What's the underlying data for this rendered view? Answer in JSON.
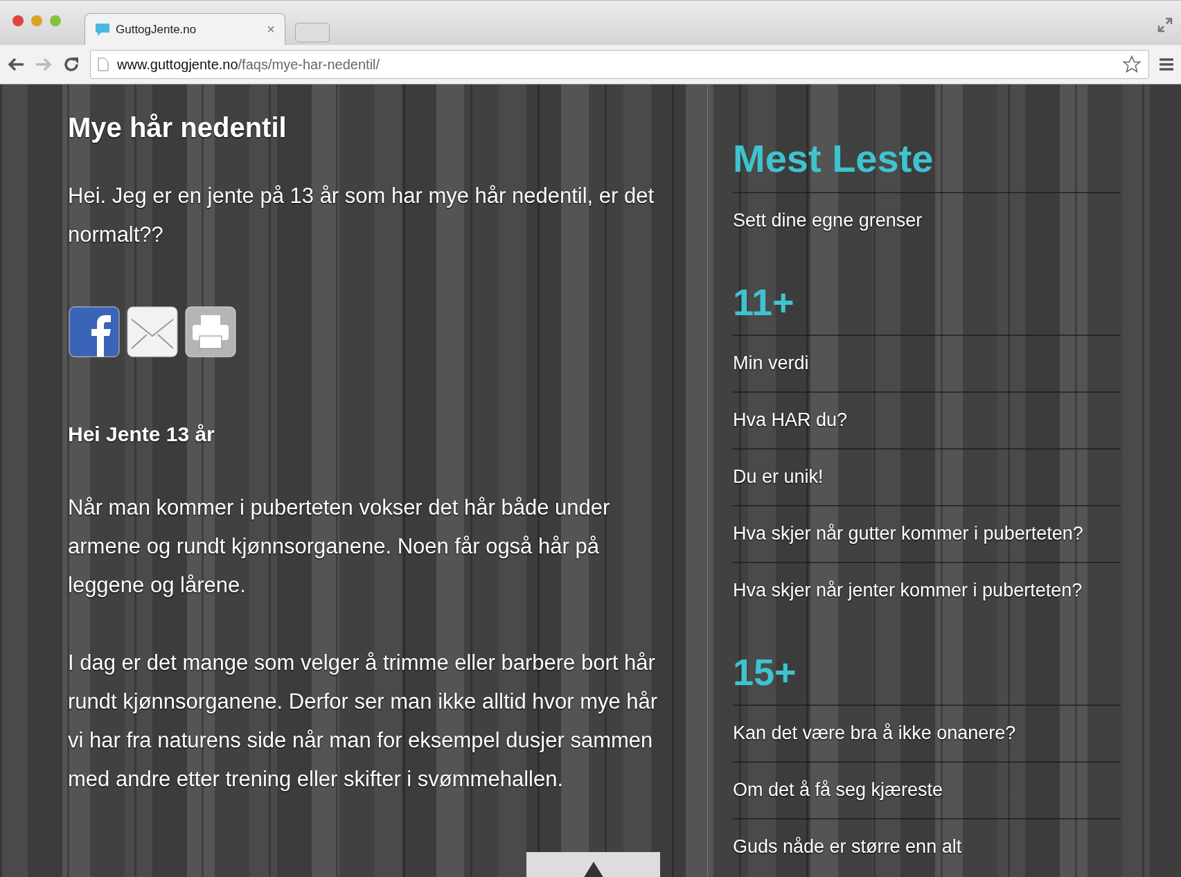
{
  "browser": {
    "tab": {
      "title": "GuttogJente.no",
      "close": "×"
    },
    "url": {
      "host": "www.guttogjente.no",
      "path": "/faqs/mye-har-nedentil/"
    }
  },
  "article": {
    "title": "Mye hår nedentil",
    "question": "Hei. Jeg er en jente på 13 år som har mye hår nedentil, er det normalt??",
    "greeting": "Hei Jente 13 år",
    "paragraphs": [
      "Når man kommer i puberteten vokser det hår både under armene og rundt kjønnsorganene. Noen får også hår på leggene og lårene.",
      "I dag er det mange som velger å trimme eller barbere bort hår rundt kjønnsorganene. Derfor ser man ikke alltid hvor mye hår vi har fra naturens side når man for eksempel dusjer sammen med andre etter trening eller skifter i svømmehallen."
    ]
  },
  "sidebar": {
    "sections": [
      {
        "kind": "title",
        "heading": "Mest Leste",
        "items": [
          "Sett dine egne grenser"
        ]
      },
      {
        "kind": "age",
        "heading": "11+",
        "items": [
          "Min verdi",
          "Hva HAR du?",
          "Du er unik!",
          "Hva skjer når gutter kommer i puberteten?",
          "Hva skjer når jenter kommer i puberteten?"
        ]
      },
      {
        "kind": "age",
        "heading": "15+",
        "items": [
          "Kan det være bra å ikke onanere?",
          "Om det å få seg kjæreste",
          "Guds nåde er større enn alt"
        ]
      }
    ]
  }
}
